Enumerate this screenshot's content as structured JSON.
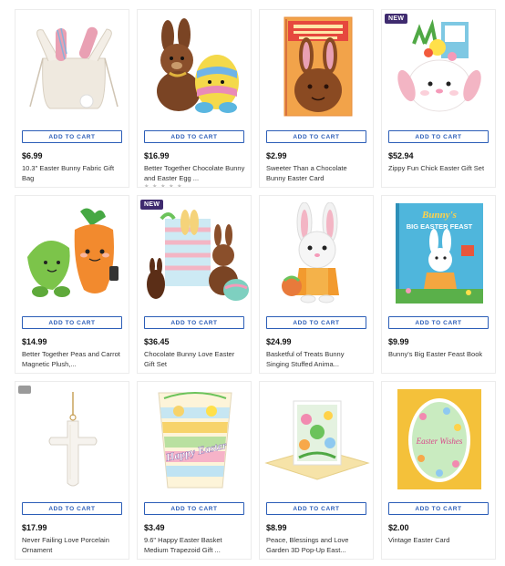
{
  "products": [
    {
      "price": "$6.99",
      "name": "10.3\" Easter Bunny Fabric Gift Bag",
      "button": "ADD TO CART",
      "image": "bunny-fabric-bag-image"
    },
    {
      "price": "$16.99",
      "name": "Better Together Chocolate Bunny and Easter Egg ...",
      "button": "ADD TO CART",
      "image": "chocolate-bunny-egg-plush-image"
    },
    {
      "price": "$2.99",
      "name": "Sweeter Than a Chocolate Bunny Easter Card",
      "button": "ADD TO CART",
      "image": "chocolate-bunny-card-image"
    },
    {
      "price": "$52.94",
      "name": "Zippy Fun Chick Easter Gift Set",
      "button": "ADD TO CART",
      "badge": "NEW",
      "image": "chick-gift-set-image"
    },
    {
      "price": "$14.99",
      "name": "Better Together Peas and Carrot Magnetic Plush,...",
      "button": "ADD TO CART",
      "image": "peas-carrot-plush-image"
    },
    {
      "price": "$36.45",
      "name": "Chocolate Bunny Love Easter Gift Set",
      "button": "ADD TO CART",
      "badge": "NEW",
      "image": "bunny-love-gift-set-image"
    },
    {
      "price": "$24.99",
      "name": "Basketful of Treats Bunny Singing Stuffed Anima...",
      "button": "ADD TO CART",
      "image": "singing-bunny-plush-image"
    },
    {
      "price": "$9.99",
      "name": "Bunny's Big Easter Feast Book",
      "button": "ADD TO CART",
      "image": "easter-feast-book-image",
      "book_title_line1": "Bunny's",
      "book_title_line2": "BIG EASTER FEAST"
    },
    {
      "price": "$17.99",
      "name": "Never Failing Love Porcelain Ornament",
      "button": "ADD TO CART",
      "image": "porcelain-cross-ornament-image"
    },
    {
      "price": "$3.49",
      "name": "9.6\" Happy Easter Basket Medium Trapezoid Gift ...",
      "button": "ADD TO CART",
      "image": "happy-easter-gift-bag-image",
      "bag_text": "Happy Easter"
    },
    {
      "price": "$8.99",
      "name": "Peace, Blessings and Love Garden 3D Pop-Up East...",
      "button": "ADD TO CART",
      "image": "popup-garden-card-image"
    },
    {
      "price": "$2.00",
      "name": "Vintage Easter Card",
      "button": "ADD TO CART",
      "image": "easter-wishes-card-image",
      "card_text": "Easter Wishes"
    }
  ],
  "colors": {
    "button_border": "#2b5db7",
    "badge_new": "#3f2b6f"
  }
}
